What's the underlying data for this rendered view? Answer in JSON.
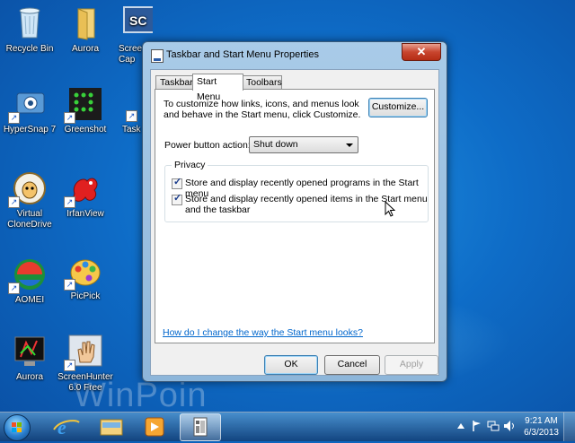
{
  "desktop": {
    "icons": [
      {
        "label": "Recycle Bin",
        "icon": "recycle-bin-icon"
      },
      {
        "label": "Aurora",
        "icon": "folder-icon"
      },
      {
        "label": "Scree\nCap",
        "icon": "screencap-icon",
        "badge": "SC"
      },
      {
        "label": "HyperSnap 7",
        "icon": "hypersnap-icon"
      },
      {
        "label": "Greenshot",
        "icon": "greenshot-icon"
      },
      {
        "label": "Task",
        "icon": "task-icon"
      },
      {
        "label": "Virtual\nCloneDrive",
        "icon": "clonedrive-sheep-icon"
      },
      {
        "label": "IrfanView",
        "icon": "irfanview-icon"
      },
      {
        "label": "AOMEI",
        "icon": "aomei-icon"
      },
      {
        "label": "PicPick",
        "icon": "picpick-icon"
      },
      {
        "label": "Aurora",
        "icon": "aurora-monitor-icon"
      },
      {
        "label": "ScreenHunter\n6.0 Free",
        "icon": "screenhunter-hand-icon"
      }
    ],
    "watermark": "WinPoin"
  },
  "window": {
    "title": "Taskbar and Start Menu Properties",
    "close_label": "✕",
    "tabs": [
      {
        "label": "Taskbar"
      },
      {
        "label": "Start Menu"
      },
      {
        "label": "Toolbars"
      }
    ],
    "active_tab": "Start Menu",
    "description": "To customize how links, icons, and menus look and behave in the Start menu, click Customize.",
    "customize_label": "Customize...",
    "power_button": {
      "label": "Power button action:",
      "value": "Shut down"
    },
    "privacy": {
      "title": "Privacy",
      "options": [
        {
          "label": "Store and display recently opened programs in the Start menu",
          "checked": true
        },
        {
          "label": "Store and display recently opened items in the Start menu and the taskbar",
          "checked": true
        }
      ]
    },
    "help_link": "How do I change the way the Start menu looks?",
    "buttons": {
      "ok": "OK",
      "cancel": "Cancel",
      "apply": "Apply"
    }
  },
  "taskbar": {
    "pinned": [
      {
        "name": "internet-explorer-icon"
      },
      {
        "name": "windows-explorer-icon"
      },
      {
        "name": "media-player-icon"
      },
      {
        "name": "taskbar-properties-icon",
        "active": true
      }
    ],
    "time": "9:21 AM",
    "date": "6/3/2013"
  },
  "colors": {
    "desktop_bg": "#0e6cc7",
    "window_frame": "#a9cbe8",
    "link": "#0066cc",
    "close_button": "#c8452e"
  }
}
